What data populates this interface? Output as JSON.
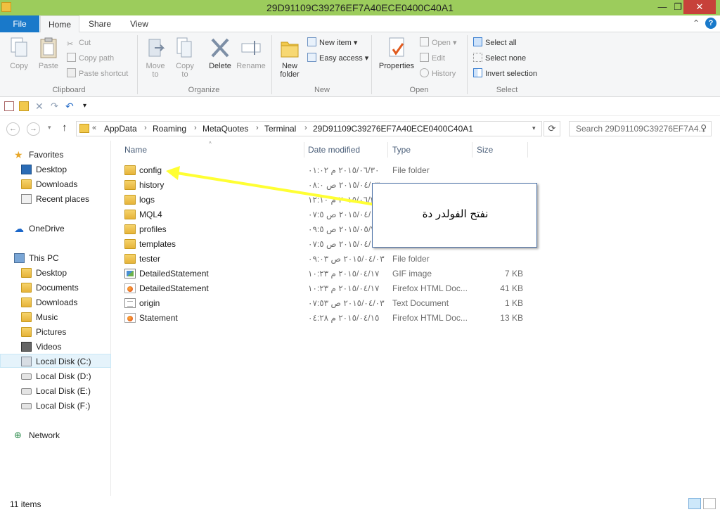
{
  "window": {
    "title": "29D91109C39276EF7A40ECE0400C40A1",
    "minimize": "—",
    "maximize": "❐",
    "close": "✕"
  },
  "ribbon_tabs": {
    "file": "File",
    "home": "Home",
    "share": "Share",
    "view": "View"
  },
  "ribbon": {
    "clipboard": {
      "label": "Clipboard",
      "copy": "Copy",
      "paste": "Paste",
      "cut": "Cut",
      "copy_path": "Copy path",
      "paste_shortcut": "Paste shortcut"
    },
    "organize": {
      "label": "Organize",
      "move_to": "Move to",
      "copy_to": "Copy to",
      "delete": "Delete",
      "rename": "Rename"
    },
    "new": {
      "label": "New",
      "new_folder": "New folder",
      "new_item": "New item",
      "easy_access": "Easy access"
    },
    "open": {
      "label": "Open",
      "properties": "Properties",
      "open": "Open",
      "edit": "Edit",
      "history": "History"
    },
    "select": {
      "label": "Select",
      "select_all": "Select all",
      "select_none": "Select none",
      "invert_selection": "Invert selection"
    }
  },
  "address": {
    "overflow": "«",
    "crumbs": [
      "AppData",
      "Roaming",
      "MetaQuotes",
      "Terminal",
      "29D91109C39276EF7A40ECE0400C40A1"
    ],
    "search_placeholder": "Search 29D91109C39276EF7A4..."
  },
  "nav": {
    "favorites": "Favorites",
    "desktop": "Desktop",
    "downloads": "Downloads",
    "recent_places": "Recent places",
    "onedrive": "OneDrive",
    "this_pc": "This PC",
    "pc_desktop": "Desktop",
    "documents": "Documents",
    "pc_downloads": "Downloads",
    "music": "Music",
    "pictures": "Pictures",
    "videos": "Videos",
    "disk_c": "Local Disk (C:)",
    "disk_d": "Local Disk (D:)",
    "disk_e": "Local Disk (E:)",
    "disk_f": "Local Disk (F:)",
    "network": "Network"
  },
  "columns": {
    "name": "Name",
    "date": "Date modified",
    "type": "Type",
    "size": "Size"
  },
  "files": [
    {
      "name": "config",
      "date": "٢٠١٥/٠٦/٣٠ م ٠١:٠٢",
      "type": "File folder",
      "size": "",
      "icon": "folder"
    },
    {
      "name": "history",
      "date": "٢٠١٥/٠٤/٠٣ ص ٠٨:٠",
      "type": "",
      "size": "",
      "icon": "folder"
    },
    {
      "name": "logs",
      "date": "٢٠١٥/٠٦/٣٠ م ١٢:١٠",
      "type": "",
      "size": "",
      "icon": "folder"
    },
    {
      "name": "MQL4",
      "date": "٢٠١٥/٠٤/٠٣ ص ٠٧:٥",
      "type": "",
      "size": "",
      "icon": "folder"
    },
    {
      "name": "profiles",
      "date": "٢٠١٥/٠٥/٢٦ ص ٠٩:٥",
      "type": "",
      "size": "",
      "icon": "folder"
    },
    {
      "name": "templates",
      "date": "٢٠١٥/٠٤/٠٣ ص ٠٧:٥",
      "type": "",
      "size": "",
      "icon": "folder"
    },
    {
      "name": "tester",
      "date": "٢٠١٥/٠٤/٠٣ ص ٠٩:٠٣",
      "type": "File folder",
      "size": "",
      "icon": "folder"
    },
    {
      "name": "DetailedStatement",
      "date": "٢٠١٥/٠٤/١٧ م ١٠:٢٣",
      "type": "GIF image",
      "size": "7 KB",
      "icon": "gif"
    },
    {
      "name": "DetailedStatement",
      "date": "٢٠١٥/٠٤/١٧ م ١٠:٢٣",
      "type": "Firefox HTML Doc...",
      "size": "41 KB",
      "icon": "html"
    },
    {
      "name": "origin",
      "date": "٢٠١٥/٠٤/٠٣ ص ٠٧:٥٣",
      "type": "Text Document",
      "size": "1 KB",
      "icon": "txt"
    },
    {
      "name": "Statement",
      "date": "٢٠١٥/٠٤/١٥ م ٠٤:٢٨",
      "type": "Firefox HTML Doc...",
      "size": "13 KB",
      "icon": "html"
    }
  ],
  "callout": {
    "text": "نفتح الفولدر دة"
  },
  "status": {
    "item_count": "11 items"
  },
  "colors": {
    "title_bar": "#9ccc5c",
    "file_tab": "#1979ca",
    "arrow": "#ffff33",
    "selection": "#e5f3fb"
  }
}
